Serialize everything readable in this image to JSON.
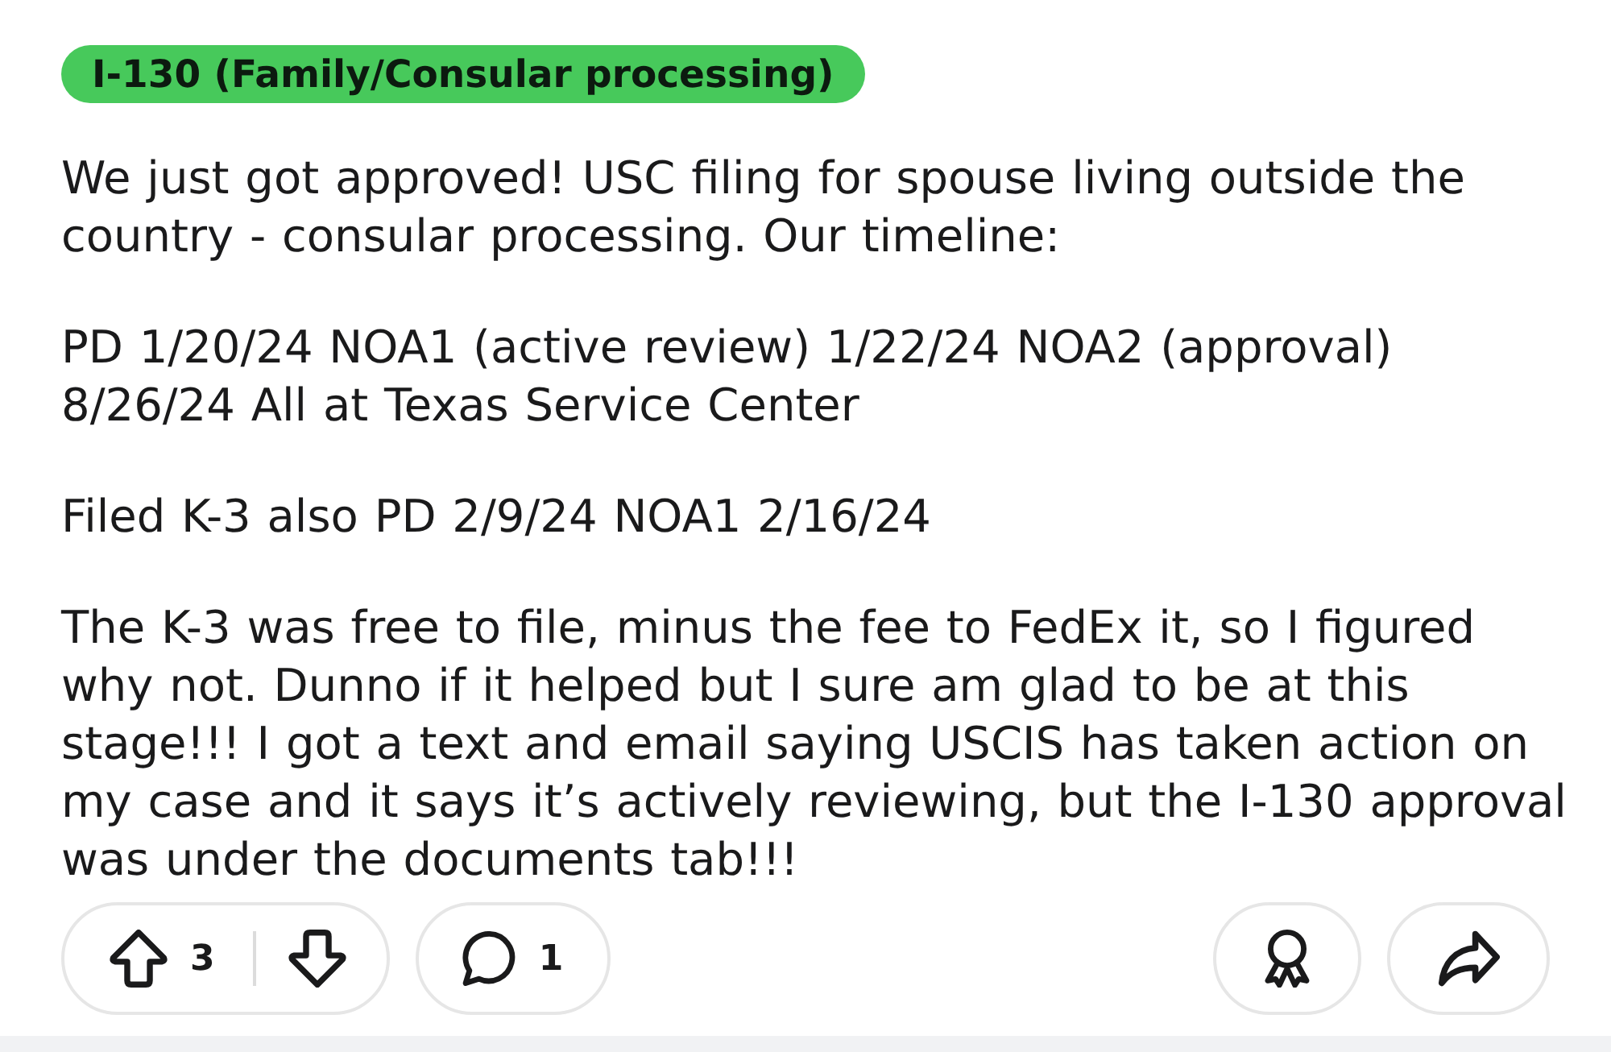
{
  "post": {
    "flair": "I-130 (Family/Consular processing)",
    "body": [
      "We just got approved! USC filing for spouse living outside the country - consular processing. Our timeline:",
      "PD 1/20/24 NOA1 (active review) 1/22/24 NOA2 (approval) 8/26/24 All at Texas Service Center",
      "Filed K-3 also PD 2/9/24 NOA1 2/16/24",
      "The K-3 was free to file, minus the fee to FedEx it, so I figured why not. Dunno if it helped but I sure am glad to be at this stage!!! I got a text and email saying USCIS has taken action on my case and it says it’s actively reviewing, but the I-130 approval was under the documents tab!!!"
    ]
  },
  "actions": {
    "score": "3",
    "comments": "1"
  }
}
